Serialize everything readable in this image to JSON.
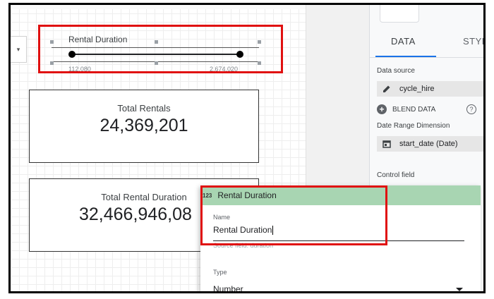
{
  "control": {
    "title": "Rental Duration",
    "min_label": "112,080",
    "max_label": "2,674,020"
  },
  "scorecards": [
    {
      "label": "Total Rentals",
      "value": "24,369,201"
    },
    {
      "label": "Total Rental Duration",
      "value": "32,466,946,08"
    }
  ],
  "side_panel": {
    "tabs": [
      "DATA",
      "STYLE"
    ],
    "data_source_label": "Data source",
    "data_source_value": "cycle_hire",
    "blend_label": "BLEND DATA",
    "date_range_label": "Date Range Dimension",
    "date_range_value": "start_date (Date)",
    "control_field_label": "Control field"
  },
  "field_editor": {
    "header": "Rental Duration",
    "type_icon_text": "123",
    "name_label": "Name",
    "name_value": "Rental Duration",
    "source_field": "Source field: duration",
    "type_label": "Type",
    "type_value": "Number"
  },
  "colors": {
    "highlight": "#e01010",
    "field_header": "#a8d5b2",
    "accent": "#1a73e8"
  }
}
